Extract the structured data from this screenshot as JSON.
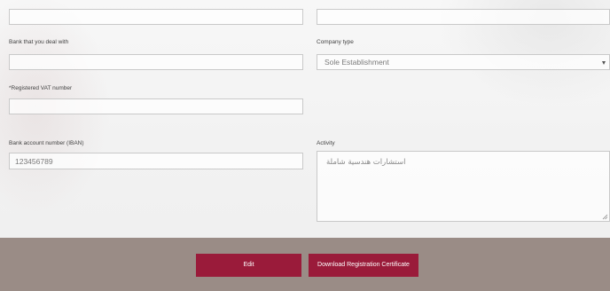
{
  "form": {
    "bank_label": "Bank that you deal with",
    "bank_value": "",
    "company_type_label": "Company type",
    "company_type_value": "Sole Establishment",
    "vat_label": "Registered VAT number",
    "vat_required_mark": "*",
    "vat_value": "",
    "iban_label": "Bank account number (IBAN)",
    "iban_value": "123456789",
    "activity_label": "Activity",
    "activity_value": "استشارات هندسية شاملة"
  },
  "footer": {
    "edit_label": "Edit",
    "download_label": "Download Registration Certificate"
  },
  "colors": {
    "accent": "#9a1b3a",
    "footer_bg": "#9a8c86"
  },
  "icons": {
    "dropdown": "caret-down-icon",
    "textarea_resize": "resize-handle-icon"
  }
}
